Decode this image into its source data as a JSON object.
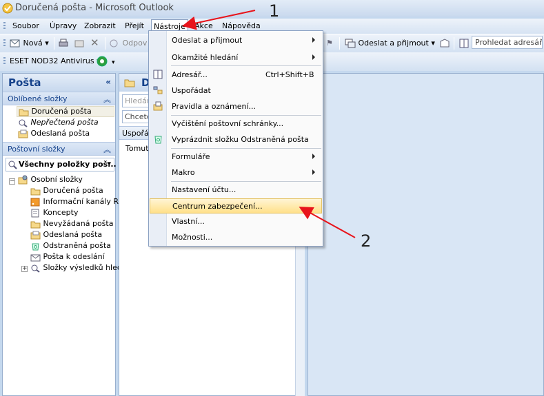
{
  "window": {
    "title": "Doručená pošta - Microsoft Outlook"
  },
  "menubar": {
    "items": [
      {
        "label": "Soubor"
      },
      {
        "label": "Úpravy"
      },
      {
        "label": "Zobrazit"
      },
      {
        "label": "Přejít"
      },
      {
        "label": "Nástroje"
      },
      {
        "label": "Akce"
      },
      {
        "label": "Nápověda"
      }
    ]
  },
  "toolbar": {
    "new_label": "Nová",
    "reply_label": "Odpov",
    "send_receive_label": "Odeslat a přijmout",
    "search_placeholder": "Prohledat adresáře",
    "antivirus_label": "ESET NOD32 Antivirus"
  },
  "nav": {
    "header": "Pošta",
    "favorites_header": "Oblíbené složky",
    "favorites": [
      {
        "label": "Doručená pošta"
      },
      {
        "label": "Nepřečtená pošta"
      },
      {
        "label": "Odeslaná pošta"
      }
    ],
    "mail_folders_header": "Poštovní složky",
    "view_selector": "Všechny položky poš...",
    "root": "Osobní složky",
    "folders": [
      {
        "label": "Doručená pošta"
      },
      {
        "label": "Informační kanály RS"
      },
      {
        "label": "Koncepty"
      },
      {
        "label": "Nevyžádaná pošta"
      },
      {
        "label": "Odeslaná pošta"
      },
      {
        "label": "Odstraněná pošta"
      },
      {
        "label": "Pošta k odeslání"
      },
      {
        "label": "Složky výsledků hled"
      }
    ]
  },
  "list": {
    "header": "D",
    "search": "Hledán",
    "filter": "Chcete",
    "arrange": "Uspořá",
    "message_preview": "Tomut"
  },
  "tools_menu": {
    "items": [
      {
        "label": "Odeslat a přijmout",
        "shortcut": "",
        "submenu": true
      },
      {
        "label": "Okamžité hledání",
        "shortcut": "",
        "submenu": true
      },
      {
        "label": "Adresář...",
        "shortcut": "Ctrl+Shift+B",
        "submenu": false
      },
      {
        "label": "Uspořádat",
        "shortcut": "",
        "submenu": false
      },
      {
        "label": "Pravidla a oznámení...",
        "shortcut": "",
        "submenu": false
      },
      {
        "label": "Vyčištění poštovní schránky...",
        "shortcut": "",
        "submenu": false
      },
      {
        "label": "Vyprázdnit složku Odstraněná pošta",
        "shortcut": "",
        "submenu": false
      },
      {
        "label": "Formuláře",
        "shortcut": "",
        "submenu": true
      },
      {
        "label": "Makro",
        "shortcut": "",
        "submenu": true
      },
      {
        "label": "Nastavení účtu...",
        "shortcut": "",
        "submenu": false
      },
      {
        "label": "Centrum zabezpečení...",
        "shortcut": "",
        "submenu": false
      },
      {
        "label": "Vlastní...",
        "shortcut": "",
        "submenu": false
      },
      {
        "label": "Možnosti...",
        "shortcut": "",
        "submenu": false
      }
    ]
  },
  "annotations": {
    "step1": "1",
    "step2": "2"
  },
  "colors": {
    "accent": "#15428b",
    "arrow": "#e8141b",
    "highlight": "#ffe08a"
  }
}
